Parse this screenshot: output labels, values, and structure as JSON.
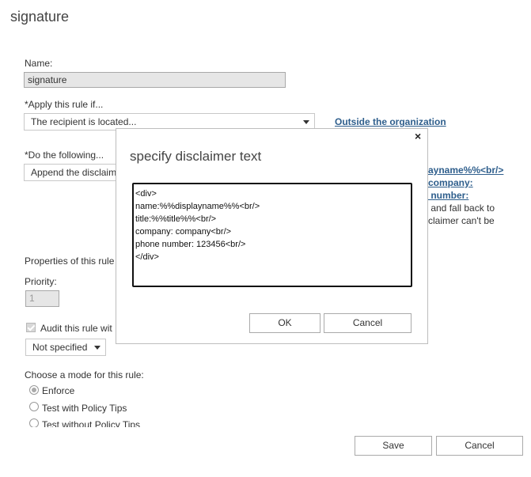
{
  "page": {
    "title": "signature"
  },
  "form": {
    "name_label": "Name:",
    "name_value": "signature",
    "apply_label": "*Apply this rule if...",
    "apply_value": "The recipient is located...",
    "apply_link": "Outside the organization",
    "do_label": "*Do the following...",
    "do_value": "Append the disclaim",
    "do_right_lines": [
      "ayname%%<br/>",
      "company:",
      " number:",
      " and fall back to",
      "claimer can't be"
    ],
    "properties_label": "Properties of this rule:",
    "priority_label": "Priority:",
    "priority_value": "1",
    "audit_label": "Audit this rule wit",
    "severity_value": "Not specified",
    "mode_label": "Choose a mode for this rule:",
    "modes": [
      "Enforce",
      "Test with Policy Tips",
      "Test without Policy Tips"
    ]
  },
  "dialog": {
    "title": "specify disclaimer text",
    "close_icon": "×",
    "editor_lines": [
      "<div>",
      "name:%%displayname%%<br/>",
      "title:%%title%%<br/>",
      "company: company<br/>",
      "phone number: 123456<br/>",
      "</div>"
    ],
    "ok_label": "OK",
    "cancel_label": "Cancel"
  },
  "footer": {
    "save_label": "Save",
    "cancel_label": "Cancel"
  }
}
